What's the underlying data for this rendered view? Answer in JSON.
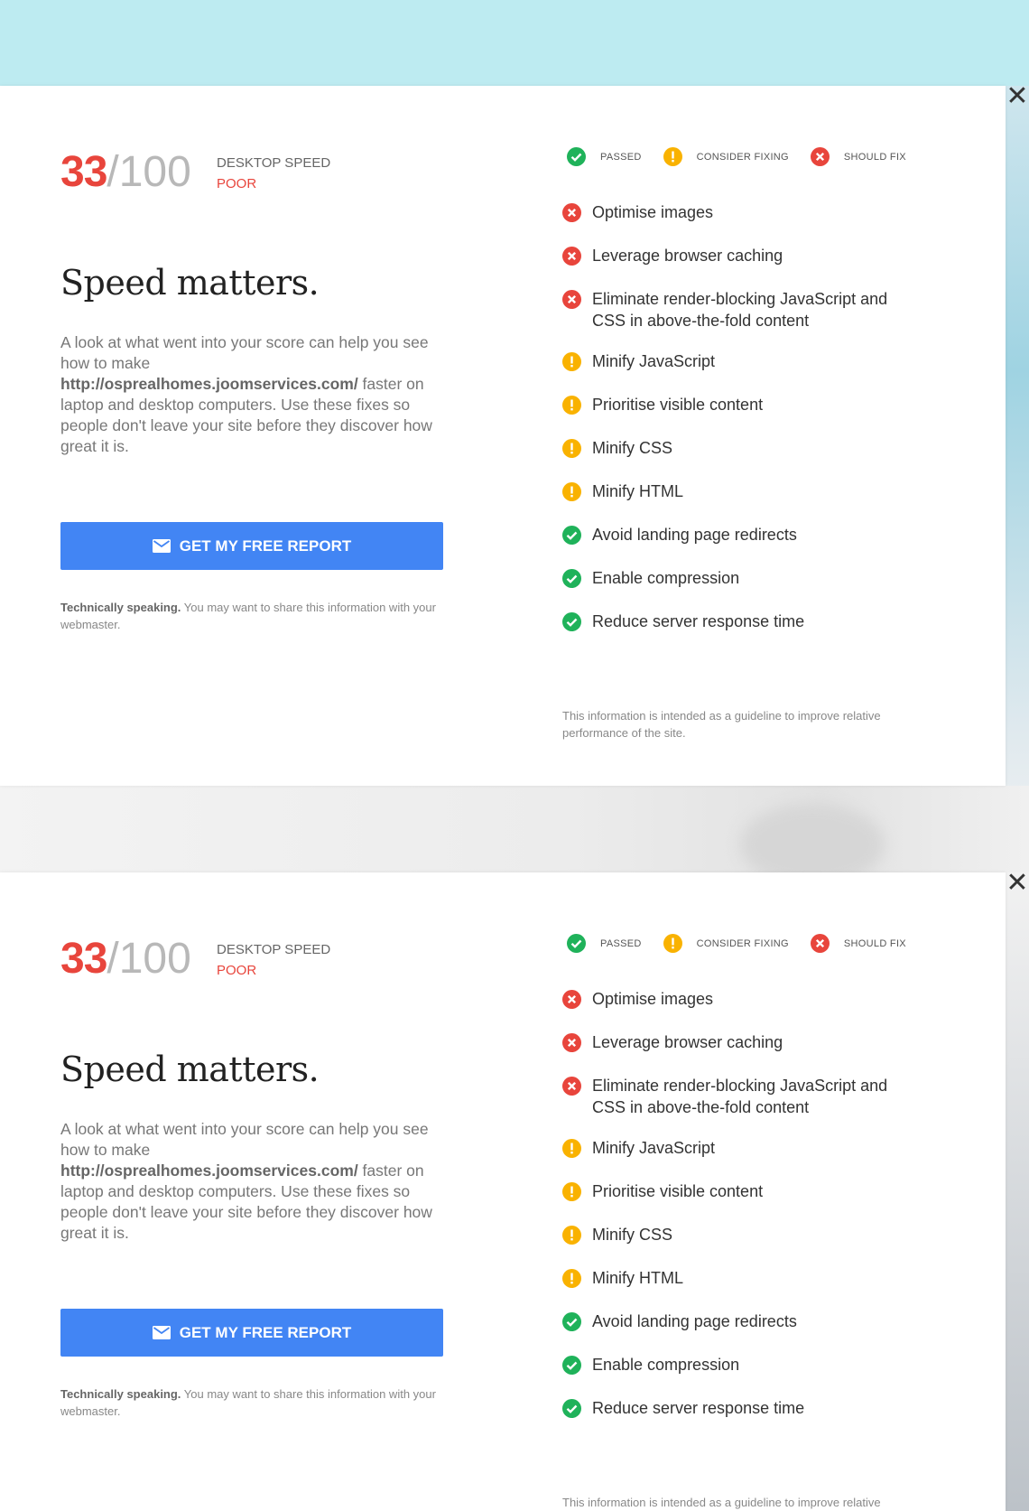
{
  "close_label": "✕",
  "score": {
    "value": "33",
    "denominator": "/100",
    "label": "DESKTOP SPEED",
    "rating": "POOR"
  },
  "headline": "Speed matters.",
  "description": {
    "before": "A look at what went into your score can help you see how to make ",
    "url": "http://osprealhomes.joomservices.com/",
    "after": " faster on laptop and desktop computers. Use these fixes so people don't leave your site before they discover how great it is."
  },
  "cta_label": "GET MY FREE REPORT",
  "tech": {
    "bold": "Technically speaking.",
    "rest": " You may want to share this information with your webmaster."
  },
  "legend": {
    "passed": "PASSED",
    "consider": "CONSIDER FIXING",
    "should": "SHOULD FIX"
  },
  "items": [
    {
      "label": "Optimise images",
      "status": "fail"
    },
    {
      "label": "Leverage browser caching",
      "status": "fail"
    },
    {
      "label": "Eliminate render-blocking JavaScript and CSS in above-the-fold content",
      "status": "fail"
    },
    {
      "label": "Minify JavaScript",
      "status": "warn"
    },
    {
      "label": "Prioritise visible content",
      "status": "warn"
    },
    {
      "label": "Minify CSS",
      "status": "warn"
    },
    {
      "label": "Minify HTML",
      "status": "warn"
    },
    {
      "label": "Avoid landing page redirects",
      "status": "pass"
    },
    {
      "label": "Enable compression",
      "status": "pass"
    },
    {
      "label": "Reduce server response time",
      "status": "pass"
    }
  ],
  "footnote": "This information is intended as a guideline to improve relative performance of the site.",
  "colors": {
    "pass": "#1fb25a",
    "warn": "#f9b200",
    "fail": "#e8453c",
    "cta": "#4285f4"
  }
}
